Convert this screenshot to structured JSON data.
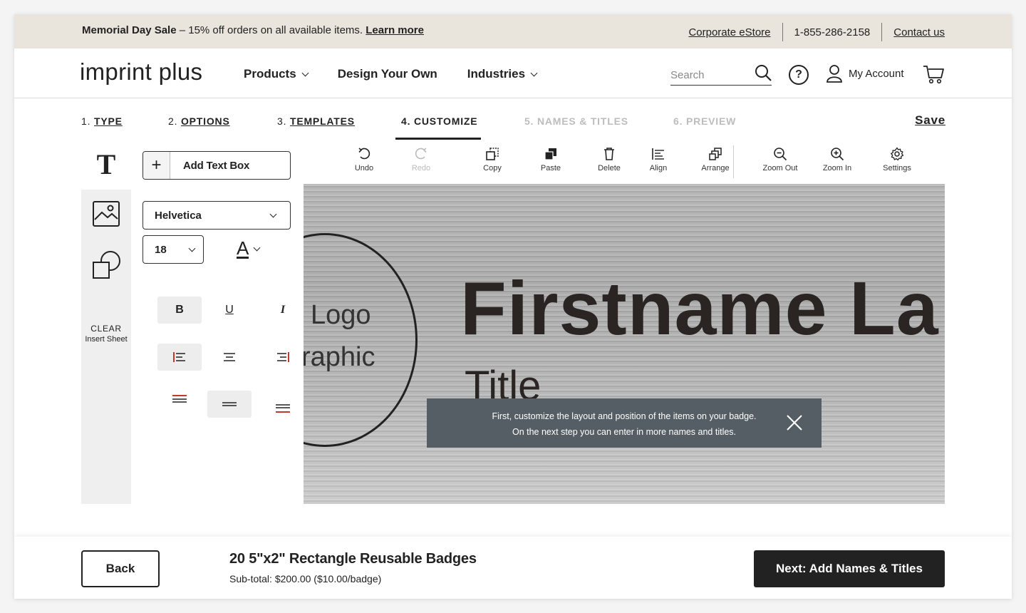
{
  "promo": {
    "sale_title": "Memorial Day Sale",
    "sale_text": " – 15% off orders on all available items. ",
    "learn_more": "Learn more",
    "corporate": "Corporate eStore",
    "phone": "1-855-286-2158",
    "contact": "Contact us"
  },
  "header": {
    "logo": "imprint plus",
    "nav": [
      "Products",
      "Design Your Own",
      "Industries"
    ],
    "search_placeholder": "Search",
    "help": "?",
    "account": "My Account"
  },
  "steps": {
    "items": [
      {
        "num": "1.",
        "label": "TYPE"
      },
      {
        "num": "2.",
        "label": "OPTIONS"
      },
      {
        "num": "3.",
        "label": "TEMPLATES"
      },
      {
        "num": "4.",
        "label": "CUSTOMIZE"
      },
      {
        "num": "5.",
        "label": "NAMES & TITLES"
      },
      {
        "num": "6.",
        "label": "PREVIEW"
      }
    ],
    "active_step": 4,
    "save": "Save"
  },
  "rail": {
    "text_tab": "T",
    "clear": "CLEAR",
    "insert_sheet": "Insert Sheet"
  },
  "text_panel": {
    "add_text_plus": "+",
    "add_text_box": "Add Text Box",
    "font": "Helvetica",
    "size": "18",
    "color_letter": "A",
    "bold": "B",
    "underline": "U",
    "italic": "I"
  },
  "toolbar": {
    "undo": "Undo",
    "redo": "Redo",
    "copy": "Copy",
    "paste": "Paste",
    "delete": "Delete",
    "align": "Align",
    "arrange": "Arrange",
    "zoom_out": "Zoom Out",
    "zoom_in": "Zoom In",
    "settings": "Settings"
  },
  "canvas": {
    "logo_text": "Logo",
    "graphic_text": "raphic",
    "name_text": "Firstname La",
    "title_text": "Title",
    "tooltip_line1": "First, customize the layout and position of the items on your badge.",
    "tooltip_line2": "On the next step you can enter in more names and titles."
  },
  "footer": {
    "back": "Back",
    "product_name": "20 5\"x2\" Rectangle Reusable Badges",
    "subtotal": "Sub-total: $200.00 ($10.00/badge)",
    "next": "Next: Add Names & Titles"
  },
  "colors": {
    "promo_bg": "#e9e4dc",
    "tooltip_bg": "#545e64",
    "primary_button": "#222222",
    "align_accent": "#c0392b"
  }
}
